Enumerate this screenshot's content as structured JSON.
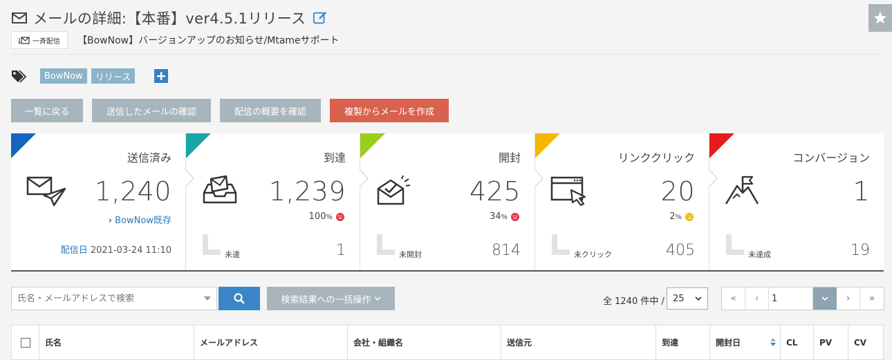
{
  "header": {
    "title": "メールの詳細:【本番】ver4.5.1リリース",
    "bulk_label": "一斉配信",
    "subtitle": "【BowNow】バージョンアップのお知らせ/Mtameサポート"
  },
  "tags": [
    "BowNow",
    "リリース"
  ],
  "actions": {
    "back": "一覧に戻る",
    "sent_mail": "送信したメールの確認",
    "overview": "配信の概要を確認",
    "duplicate": "複製からメールを作成"
  },
  "stats": [
    {
      "label": "送信済み",
      "value": "1,240",
      "link": "BowNow既存",
      "date_label": "配信日",
      "date": "2021-03-24 11:10",
      "color": "#1565c0"
    },
    {
      "label": "到達",
      "value": "1,239",
      "percent": "100",
      "unit": "%",
      "sub_label": "未達",
      "sub_value": "1",
      "color": "#19a5a5",
      "face": "#e23a4a"
    },
    {
      "label": "開封",
      "value": "425",
      "percent": "34",
      "unit": "%",
      "sub_label": "未開封",
      "sub_value": "814",
      "color": "#9acd1e",
      "face": "#e23a4a"
    },
    {
      "label": "リンククリック",
      "value": "20",
      "percent": "2",
      "unit": "%",
      "sub_label": "未クリック",
      "sub_value": "405",
      "color": "#f5b800",
      "face": "#f2b90f"
    },
    {
      "label": "コンバージョン",
      "value": "1",
      "sub_label": "未達成",
      "sub_value": "19",
      "color": "#e51c1c"
    }
  ],
  "search": {
    "placeholder": "氏名・メールアドレスで検索",
    "bulk_action": "検索結果への一括操作",
    "count_text": "全 1240 件中 /",
    "per_page": "25",
    "page": "1"
  },
  "table": {
    "columns": [
      "氏名",
      "メールアドレス",
      "会社・組織名",
      "送信元",
      "到達",
      "開封日",
      "CL",
      "PV",
      "CV"
    ]
  }
}
